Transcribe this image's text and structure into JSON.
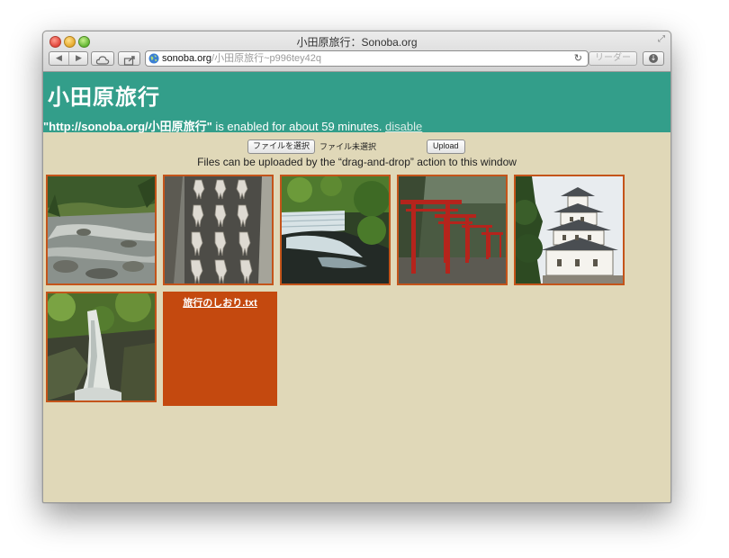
{
  "window": {
    "title": "小田原旅行：Sonoba.org",
    "url_host": "sonoba.org",
    "url_path": "/小田原旅行~p996tey42q",
    "reader_label": "リーダー",
    "icons": [
      "back-arrow",
      "forward-arrow",
      "icloud-tabs",
      "share",
      "globe",
      "reload",
      "downloads",
      "fullscreen"
    ]
  },
  "header": {
    "title": "小田原旅行",
    "status_url": "\"http://sonoba.org/小田原旅行\"",
    "status_text": " is enabled for about 59 minutes. ",
    "disable_label": "disable",
    "background": "#339e8a"
  },
  "upload": {
    "choose_file_label": "ファイルを選択",
    "no_file_text": "ファイル未選択",
    "upload_label": "Upload",
    "hint": "Files can be uploaded by the “drag-and-drop” action to this window"
  },
  "files": [
    {
      "type": "image",
      "subject": "rocky river stream"
    },
    {
      "type": "image",
      "subject": "drying squid"
    },
    {
      "type": "image",
      "subject": "small waterfall weir"
    },
    {
      "type": "image",
      "subject": "red torii gates"
    },
    {
      "type": "image",
      "subject": "Odawara castle"
    },
    {
      "type": "image",
      "subject": "waterfall in forest"
    },
    {
      "type": "text",
      "name": "旅行のしおり.txt"
    }
  ],
  "colors": {
    "page_background": "#e0d8b8",
    "tile_border": "#c4541a",
    "file_tile": "#c4490f"
  }
}
